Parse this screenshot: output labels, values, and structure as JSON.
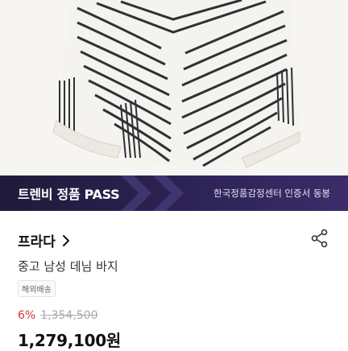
{
  "banner": {
    "left_label": "트렌비 정품 PASS",
    "right_label": "한국정품감정센터 인증서 동봉"
  },
  "product": {
    "brand": "프라다",
    "title": "중고 남성 데님 바지",
    "badge": "해외배송",
    "discount": "6%",
    "original_price": "1,354,500",
    "price": "1,279,100원"
  },
  "colors": {
    "banner_bg": "#2a2150",
    "discount": "#d13a2c",
    "stripe": "#2f3134"
  },
  "icons": {
    "brand_arrow": "chevron-right-icon",
    "share": "share-icon"
  }
}
